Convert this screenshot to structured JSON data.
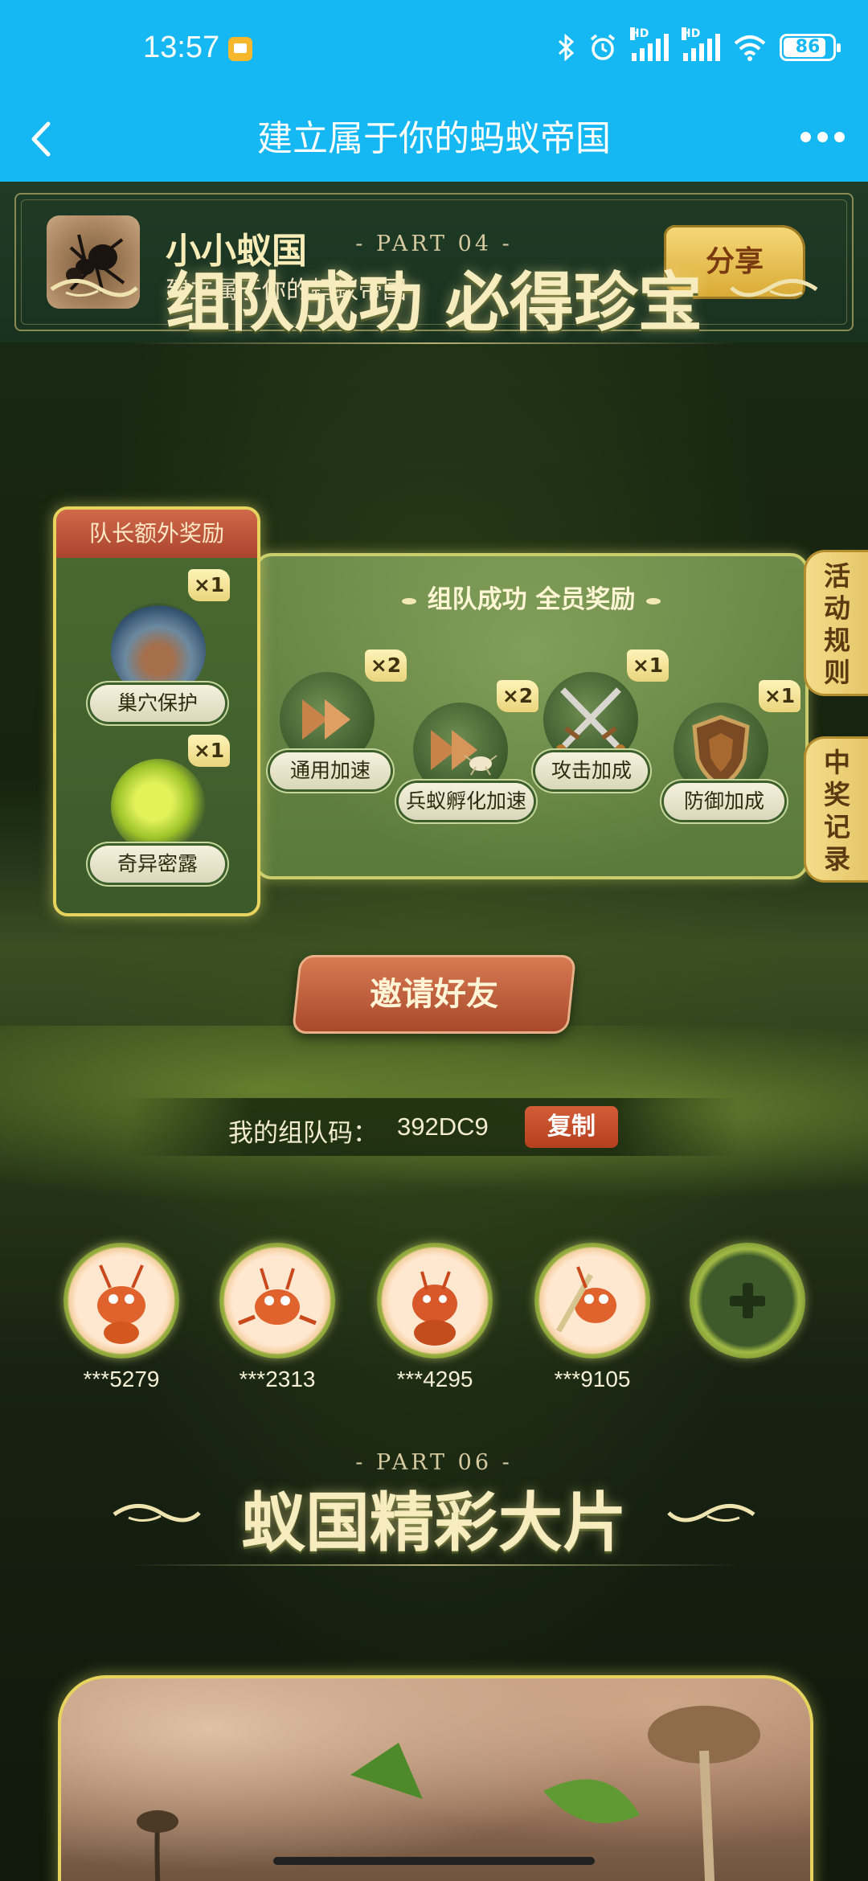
{
  "status_bar": {
    "time": "13:57",
    "battery": "86",
    "icons": [
      "bluetooth-icon",
      "alarm-icon",
      "signal-hd-icon",
      "signal-hd-icon",
      "wifi-icon",
      "battery-icon"
    ]
  },
  "title_bar": {
    "title": "建立属于你的蚂蚁帝国",
    "back_icon": "chevron-left-icon",
    "more_icon": "more-icon"
  },
  "game": {
    "name": "小小蚁国",
    "description": "建立属于你的蚂蚁帝国",
    "share_label": "分享"
  },
  "part04": {
    "label": "- PART 04 -",
    "title": "组队成功 必得珍宝"
  },
  "captain": {
    "title": "队长额外奖励",
    "rewards": [
      {
        "name": "巢穴保护",
        "count": "×1"
      },
      {
        "name": "奇异密露",
        "count": "×1"
      }
    ]
  },
  "team": {
    "title": "组队成功 全员奖励",
    "rewards": [
      {
        "name": "通用加速",
        "count": "×2"
      },
      {
        "name": "兵蚁孵化加速",
        "count": "×2"
      },
      {
        "name": "攻击加成",
        "count": "×1"
      },
      {
        "name": "防御加成",
        "count": "×1"
      }
    ]
  },
  "side_tabs": {
    "rules": [
      "活",
      "动",
      "规",
      "则"
    ],
    "records": [
      "中",
      "奖",
      "记",
      "录"
    ]
  },
  "invite": {
    "label": "邀请好友",
    "code_label": "我的组队码：",
    "code_value": "392DC9",
    "copy_label": "复制"
  },
  "members": [
    {
      "id": "***5279"
    },
    {
      "id": "***2313"
    },
    {
      "id": "***4295"
    },
    {
      "id": "***9105"
    }
  ],
  "part06": {
    "label": "- PART 06 -",
    "title": "蚁国精彩大片"
  },
  "colors": {
    "header_blue": "#15b8f2",
    "gold": "#e6d45e",
    "accent_red": "#b4401f"
  }
}
